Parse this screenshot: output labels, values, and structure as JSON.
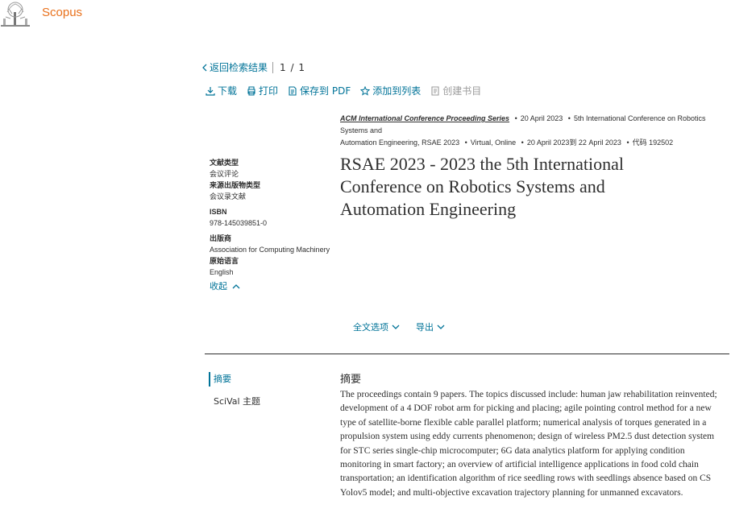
{
  "header": {
    "brand": "Scopus"
  },
  "nav": {
    "back_label": "返回检索结果",
    "pager": "1 / 1"
  },
  "actions": {
    "download": "下载",
    "print": "打印",
    "save_pdf": "保存到 PDF",
    "add_list": "添加到列表",
    "bibliography": "创建书目"
  },
  "meta": {
    "series": "ACM International Conference Proceeding Series",
    "date": "20 April 2023",
    "conference_line1": "5th International Conference on Robotics Systems and",
    "conference_line2": "Automation Engineering, RSAE 2023",
    "location": "Virtual, Online",
    "dates_range": "20 April 2023到 22 April 2023",
    "code": "代码 192502"
  },
  "title": "RSAE 2023 - 2023 the 5th International Conference on Robotics Systems and Automation Engineering",
  "details": {
    "doc_type_label": "文献类型",
    "doc_type": "会议评论",
    "source_type_label": "来源出版物类型",
    "source_type": "会议录文献",
    "isbn_label": "ISBN",
    "isbn": "978-145039851-0",
    "publisher_label": "出版商",
    "publisher": "Association for Computing Machinery",
    "language_label": "原始语言",
    "language": "English",
    "collapse": "收起"
  },
  "toolbar2": {
    "full_text": "全文选项",
    "export": "导出"
  },
  "sidebar": {
    "abstract": "摘要",
    "scival": "SciVal 主题"
  },
  "abstract": {
    "heading": "摘要",
    "text": "The proceedings contain 9 papers. The topics discussed include: human jaw rehabilitation reinvented; development of a 4 DOF robot arm for picking and placing; agile pointing control method for a new type of satellite-borne flexible cable parallel platform; numerical analysis of torques generated in a propulsion system using eddy currents phenomenon; design of wireless PM2.5 dust detection system for STC series single-chip microcomputer; 6G data analytics platform for applying condition monitoring in smart factory; an overview of artificial intelligence applications in food cold chain transportation; an identification algorithm of rice seedling rows with seedlings absence based on CS Yolov5 model; and multi-objective excavation trajectory planning for unmanned excavators."
  },
  "colors": {
    "link": "#007398",
    "brand": "#e9711c",
    "text": "#2e2e2e"
  }
}
